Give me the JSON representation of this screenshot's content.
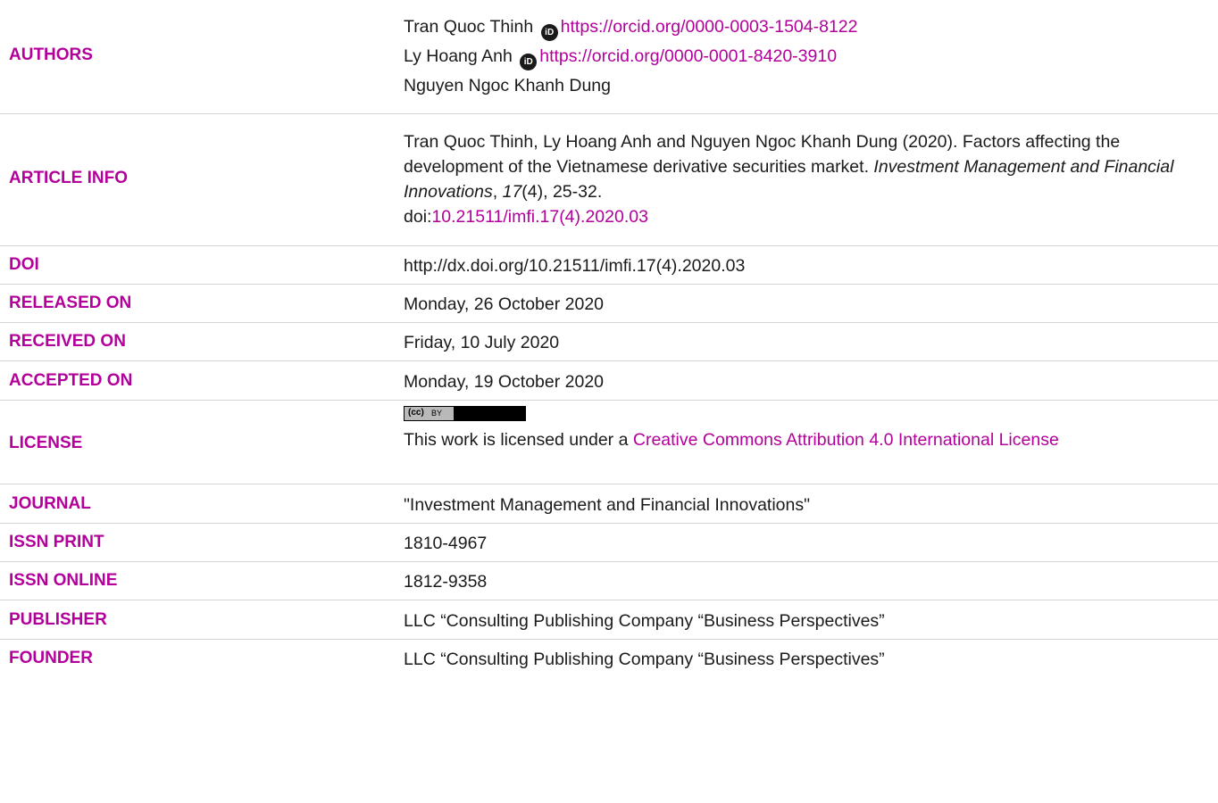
{
  "authors": {
    "label": "AUTHORS",
    "list": [
      {
        "name": "Tran Quoc Thinh",
        "orcid": "https://orcid.org/0000-0003-1504-8122"
      },
      {
        "name": "Ly Hoang Anh",
        "orcid": "https://orcid.org/0000-0001-8420-3910"
      },
      {
        "name": "Nguyen Ngoc Khanh Dung"
      }
    ],
    "orcid_icon_text": "iD"
  },
  "article_info": {
    "label": "ARTICLE INFO",
    "citation_prefix": "Tran Quoc Thinh, Ly Hoang Anh and Nguyen Ngoc Khanh Dung (2020). Factors affecting the development of the Vietnamese derivative securities market.",
    "journal_italic": "Investment Management and Financial Innovations",
    "comma": ",",
    "volume_italic": "17",
    "issue_pages": "(4), 25-32.",
    "doi_prefix": "doi:",
    "doi_link": "10.21511/imfi.17(4).2020.03"
  },
  "doi": {
    "label": "DOI",
    "value": "http://dx.doi.org/10.21511/imfi.17(4).2020.03"
  },
  "released_on": {
    "label": "RELEASED ON",
    "value": "Monday, 26 October 2020"
  },
  "received_on": {
    "label": "RECEIVED ON",
    "value": "Friday, 10 July 2020"
  },
  "accepted_on": {
    "label": "ACCEPTED ON",
    "value": "Monday, 19 October 2020"
  },
  "license": {
    "label": "LICENSE",
    "badge_cc": "(cc)",
    "badge_by": "BY",
    "text_prefix": "This work is licensed under a",
    "link": "Creative Commons Attribution 4.0 International License"
  },
  "journal": {
    "label": "JOURNAL",
    "value": "\"Investment Management and Financial Innovations\""
  },
  "issn_print": {
    "label": "ISSN PRINT",
    "value": "1810-4967"
  },
  "issn_online": {
    "label": "ISSN ONLINE",
    "value": "1812-9358"
  },
  "publisher": {
    "label": "PUBLISHER",
    "value": "LLC “Consulting Publishing Company “Business Perspectives”"
  },
  "founder": {
    "label": "FOUNDER",
    "value": "LLC “Consulting Publishing Company “Business Perspectives”"
  },
  "colors": {
    "label": "#b3009b",
    "text": "#1a1a1a",
    "divider": "#d4d4d4"
  }
}
